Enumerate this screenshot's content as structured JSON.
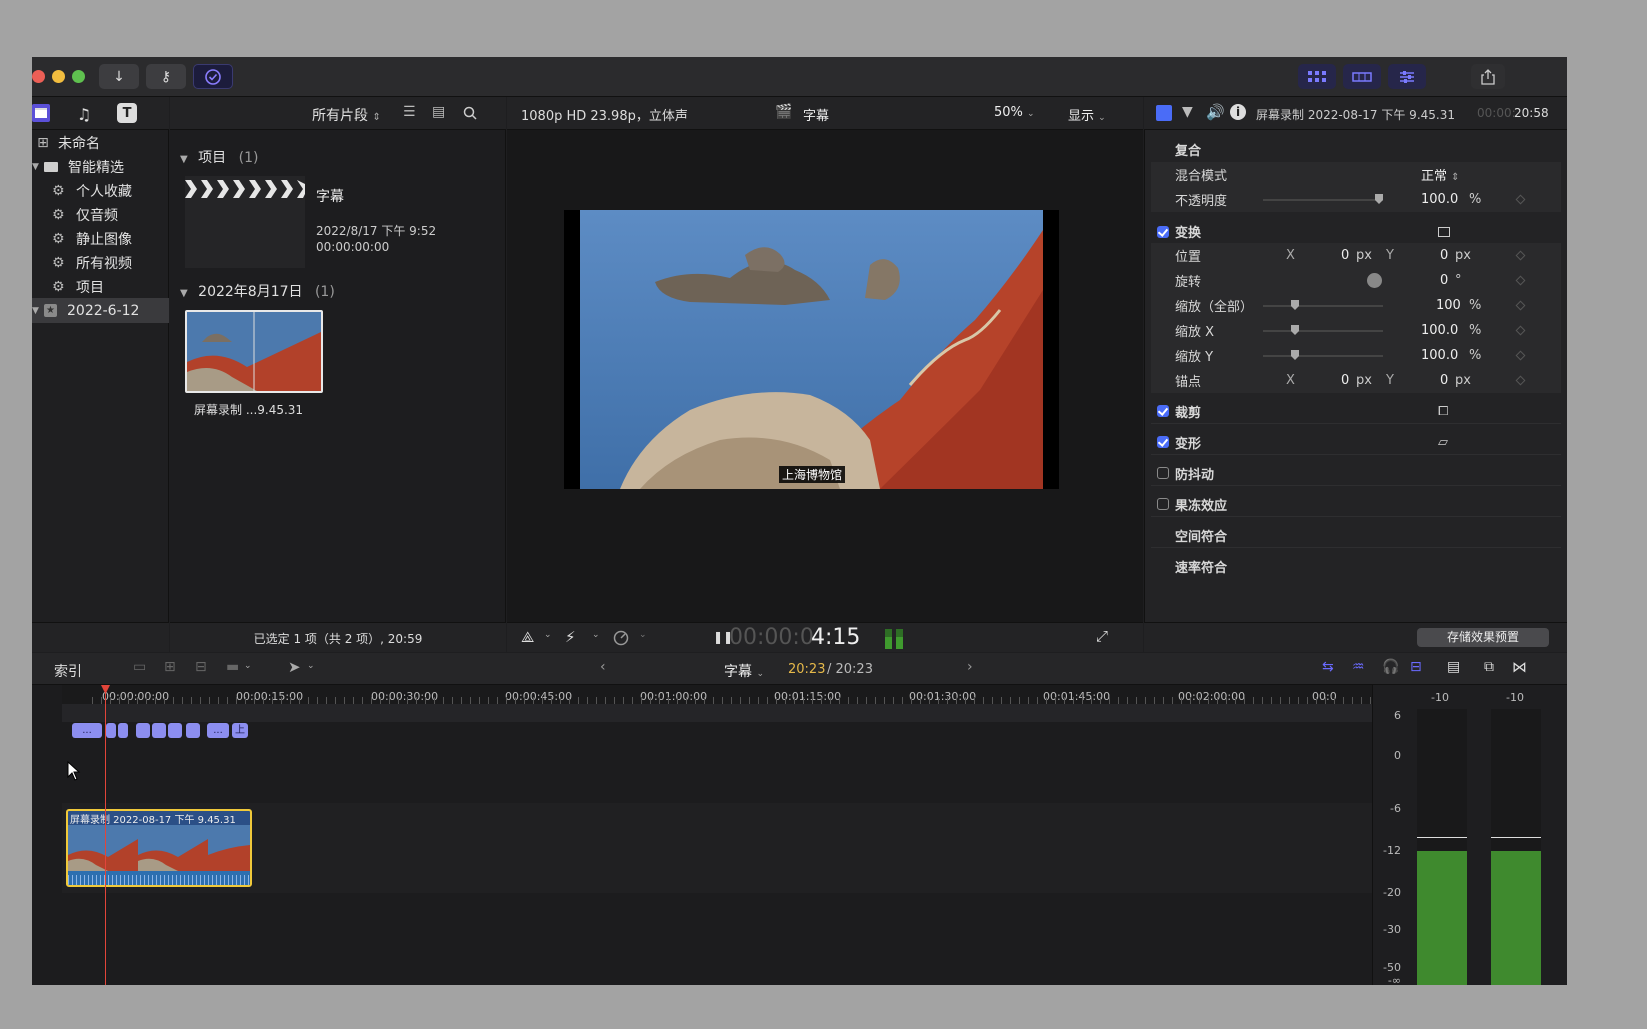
{
  "toolbar": {
    "download_icon": "download-icon",
    "key_icon": "key-icon",
    "check_icon": "check-circle-icon",
    "share_icon": "share-icon"
  },
  "library": {
    "items": [
      {
        "label": "未命名",
        "icon": "grid-icon"
      },
      {
        "label": "智能精选",
        "icon": "folder-icon"
      },
      {
        "label": "个人收藏",
        "icon": "gear-icon"
      },
      {
        "label": "仅音频",
        "icon": "gear-icon"
      },
      {
        "label": "静止图像",
        "icon": "gear-icon"
      },
      {
        "label": "所有视频",
        "icon": "gear-icon"
      },
      {
        "label": "项目",
        "icon": "gear-icon"
      },
      {
        "label": "2022-6-12",
        "icon": "star-icon"
      }
    ]
  },
  "browser": {
    "filter_label": "所有片段",
    "section1_title": "项目",
    "section1_count": "(1)",
    "project_name": "字幕",
    "project_date": "2022/8/17 下午 9:52",
    "project_duration": "00:00:00:00",
    "section2_title": "2022年8月17日",
    "section2_count": "(1)",
    "clip_name": "屏幕录制 ...9.45.31",
    "status": "已选定 1 项（共 2 项）, 20:59"
  },
  "viewer": {
    "format": "1080p HD 23.98p，立体声",
    "project": "字幕",
    "zoom": "50%",
    "display": "显示",
    "caption_text": "上海博物馆",
    "timecode_dim": "00:00:0",
    "timecode_bright": "4:15"
  },
  "inspector": {
    "clip_title": "屏幕录制 2022-08-17 下午 9.45.31",
    "duration_dim": "00:00:",
    "duration": "20:58",
    "compositing": "复合",
    "blend_mode_label": "混合模式",
    "blend_mode_value": "正常",
    "opacity_label": "不透明度",
    "opacity_value": "100.0",
    "percent": "%",
    "transform": "变换",
    "position_label": "位置",
    "x": "X",
    "y": "Y",
    "position_x": "0",
    "position_y": "0",
    "px": "px",
    "rotation_label": "旋转",
    "rotation_value": "0",
    "degree": "°",
    "scale_all_label": "缩放（全部）",
    "scale_all_value": "100",
    "scale_x_label": "缩放 X",
    "scale_x_value": "100.0",
    "scale_y_label": "缩放 Y",
    "scale_y_value": "100.0",
    "anchor_label": "锚点",
    "anchor_x": "0",
    "anchor_y": "0",
    "crop": "裁剪",
    "distort": "变形",
    "stabilization": "防抖动",
    "rolling_shutter": "果冻效应",
    "spatial_conform": "空间符合",
    "rate_conform": "速率符合",
    "save_preset": "存储效果预置"
  },
  "timeline_bar": {
    "index": "索引",
    "project": "字幕",
    "position": "20:23",
    "total": "/ 20:23"
  },
  "timeline": {
    "ruler": [
      "00:00:00:00",
      "00:00:15:00",
      "00:00:30:00",
      "00:00:45:00",
      "00:01:00:00",
      "00:01:15:00",
      "00:01:30:00",
      "00:01:45:00",
      "00:02:00:00",
      "00:0"
    ],
    "caption_chips": [
      "...",
      "",
      "",
      "",
      "",
      "",
      "",
      "...",
      "上"
    ],
    "clip_title": "屏幕录制 2022-08-17 下午 9.45.31"
  },
  "meters": {
    "channel_top": [
      "-10",
      "-10"
    ],
    "scale": [
      "6",
      "0",
      "-6",
      "-12",
      "-20",
      "-30",
      "-50",
      "-∞"
    ],
    "level_db": -12,
    "peak_db": -11,
    "color": "#3f8a2e"
  },
  "colors": {
    "accent": "#4a6cf7",
    "playhead": "#e2453a",
    "clip_border": "#f0c93a",
    "caption_chip": "#8c8ef0"
  }
}
